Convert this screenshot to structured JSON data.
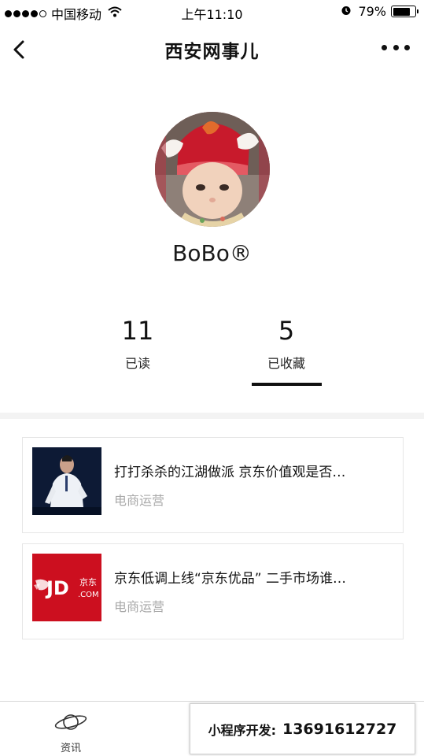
{
  "status_bar": {
    "carrier": "中国移动",
    "time": "上午11:10",
    "battery_percent": "79%",
    "battery_level": 0.79,
    "signal_filled": 4,
    "signal_total": 5,
    "icons": [
      "wifi-icon",
      "alarm-icon",
      "battery-icon"
    ]
  },
  "nav": {
    "title": "西安网事儿",
    "back_icon": "chevron-left-icon",
    "more_icon": "more-dots-icon"
  },
  "profile": {
    "username": "BoBo®"
  },
  "stats": {
    "read_count": "11",
    "read_label": "已读",
    "favorites_count": "5",
    "favorites_label": "已收藏",
    "active_tab": "已收藏"
  },
  "articles": [
    {
      "title": "打打杀杀的江湖做派 京东价值观是否…",
      "category": "电商运营"
    },
    {
      "title": "京东低调上线“京东优品” 二手市场谁…",
      "category": "电商运营"
    }
  ],
  "thumbnail_logo": {
    "text": "JD",
    "sub_cn": "京东",
    "sub_en": ".COM"
  },
  "tab_bar": {
    "news_label": "资讯",
    "news_icon": "planet-icon"
  },
  "promo": {
    "label": "小程序开发:",
    "phone": "13691612727"
  },
  "colors": {
    "jd_red": "#cc0f1f",
    "muted_text": "#a9a9a9",
    "divider": "#f3f3f3"
  }
}
